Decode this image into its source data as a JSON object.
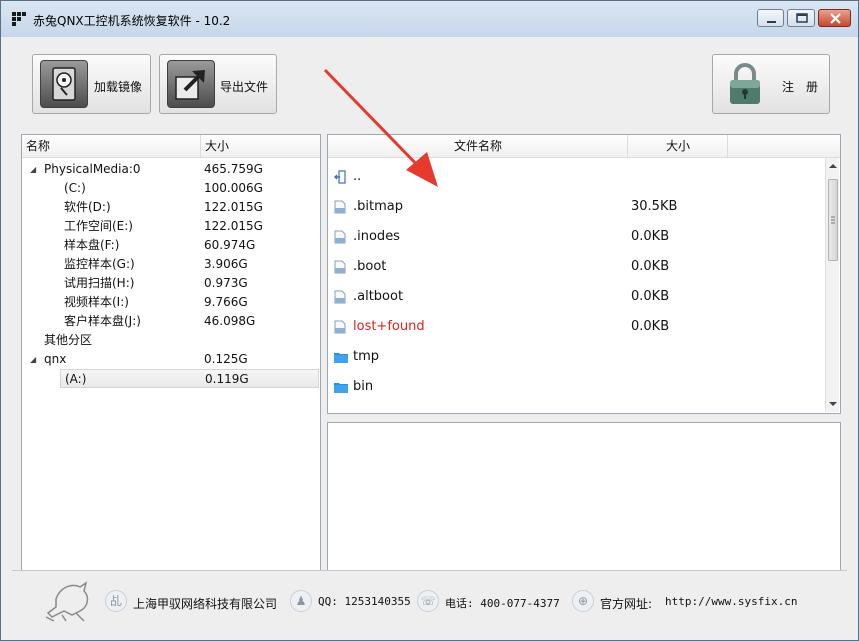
{
  "window": {
    "title": "赤兔QNX工控机系统恢复软件 - 10.2"
  },
  "toolbar": {
    "load_image_label": "加载镜像",
    "export_files_label": "导出文件",
    "register_label": "注　册"
  },
  "tree": {
    "columns": [
      "名称",
      "大小"
    ],
    "rows": [
      {
        "name": "PhysicalMedia:0",
        "size": "465.759G"
      },
      {
        "name": "(C:)",
        "size": "100.006G"
      },
      {
        "name": "软件(D:)",
        "size": "122.015G"
      },
      {
        "name": "工作空间(E:)",
        "size": "122.015G"
      },
      {
        "name": "样本盘(F:)",
        "size": "60.974G"
      },
      {
        "name": "监控样本(G:)",
        "size": "3.906G"
      },
      {
        "name": "试用扫描(H:)",
        "size": "0.973G"
      },
      {
        "name": "视频样本(I:)",
        "size": "9.766G"
      },
      {
        "name": "客户样本盘(J:)",
        "size": "46.098G"
      },
      {
        "name": "其他分区",
        "size": ""
      },
      {
        "name": "qnx",
        "size": "0.125G"
      },
      {
        "name": "(A:)",
        "size": "0.119G"
      }
    ]
  },
  "files": {
    "columns": [
      "文件名称",
      "大小"
    ],
    "rows": [
      {
        "name": "..",
        "size": "",
        "icon": "parent-folder-icon"
      },
      {
        "name": ".bitmap",
        "size": "30.5KB",
        "icon": "file-icon"
      },
      {
        "name": ".inodes",
        "size": "0.0KB",
        "icon": "file-icon"
      },
      {
        "name": ".boot",
        "size": "0.0KB",
        "icon": "file-icon"
      },
      {
        "name": ".altboot",
        "size": "0.0KB",
        "icon": "file-icon"
      },
      {
        "name": "lost+found",
        "size": "0.0KB",
        "icon": "file-icon",
        "color": "#e0211b"
      },
      {
        "name": "tmp",
        "size": "",
        "icon": "folder-icon"
      },
      {
        "name": "bin",
        "size": "",
        "icon": "folder-icon"
      }
    ]
  },
  "footer": {
    "company": "上海甲驭网络科技有限公司",
    "qq": "QQ: 1253140355",
    "phone": "电话: 400-077-4377",
    "website_label": "官方网址:",
    "website": "http://www.sysfix.cn"
  },
  "colors": {
    "highlight_text": "#e0211b",
    "folder": "#2c8fe0",
    "annotation_arrow": "#e63a2e"
  }
}
